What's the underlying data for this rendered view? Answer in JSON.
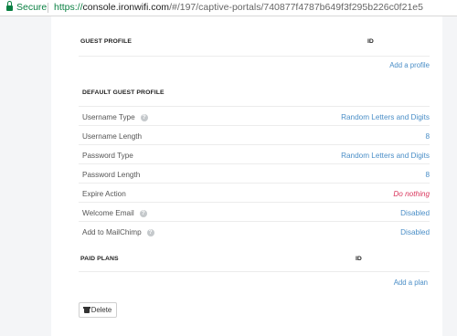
{
  "browser": {
    "secure_label": "Secure",
    "url_scheme": "https://",
    "url_host": "console.ironwifi.com",
    "url_path": "/#/197/captive-portals/740877f4787b649f3f295b226c0f21e5"
  },
  "guest_profile": {
    "header": "GUEST PROFILE",
    "id_header": "ID",
    "add_link": "Add a profile"
  },
  "default_guest_profile": {
    "header": "DEFAULT GUEST PROFILE",
    "rows": [
      {
        "label": "Username Type",
        "value": "Random Letters and Digits"
      },
      {
        "label": "Username Length",
        "value": "8"
      },
      {
        "label": "Password Type",
        "value": "Random Letters and Digits"
      },
      {
        "label": "Password Length",
        "value": "8"
      },
      {
        "label": "Expire Action",
        "value": "Do nothing"
      },
      {
        "label": "Welcome Email",
        "value": "Disabled"
      },
      {
        "label": "Add to MailChimp",
        "value": "Disabled"
      }
    ]
  },
  "paid_plans": {
    "header": "PAID PLANS",
    "id_header": "ID",
    "add_link": "Add a plan"
  },
  "actions": {
    "delete_label": "Delete"
  },
  "colors": {
    "link": "#4a8ec7",
    "warning": "#d9355c",
    "secure": "#0b8043"
  },
  "icons": {
    "lock": "lock-icon",
    "help": "help-circle-icon",
    "trash": "trash-icon"
  }
}
